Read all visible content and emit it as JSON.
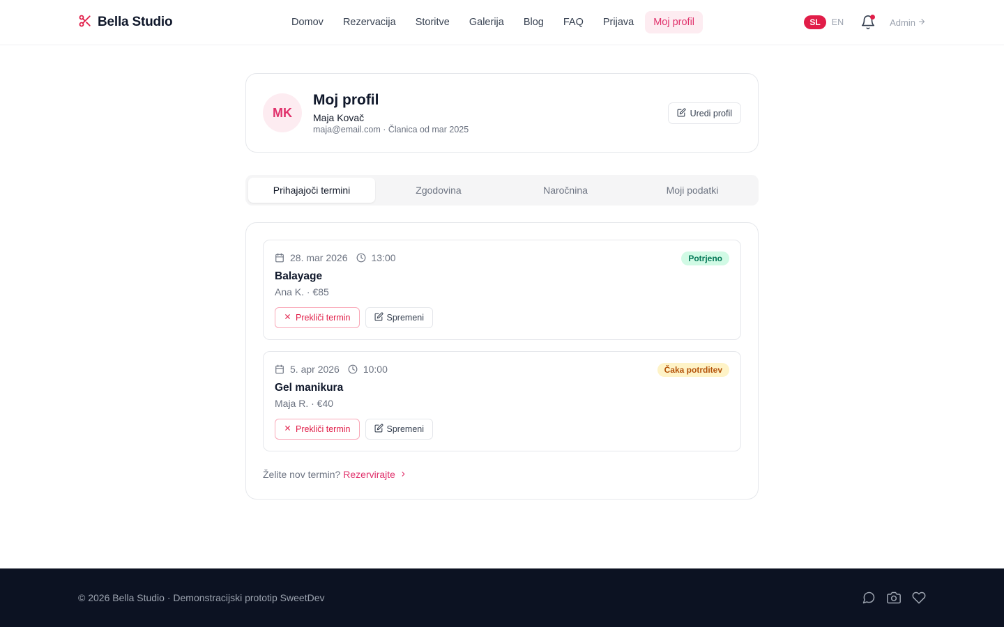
{
  "brand": {
    "name": "Bella Studio",
    "icon": "scissors-icon"
  },
  "nav": {
    "items": [
      {
        "label": "Domov"
      },
      {
        "label": "Rezervacija"
      },
      {
        "label": "Storitve"
      },
      {
        "label": "Galerija"
      },
      {
        "label": "Blog"
      },
      {
        "label": "FAQ"
      },
      {
        "label": "Prijava"
      },
      {
        "label": "Moj profil",
        "active": true
      }
    ]
  },
  "header": {
    "lang_active": "SL",
    "lang_other": "EN",
    "admin_label": "Admin",
    "notification_icon": "bell-icon"
  },
  "profile": {
    "initials": "MK",
    "title": "Moj profil",
    "name": "Maja Kovač",
    "meta": "maja@email.com · Članica od mar 2025",
    "edit_label": "Uredi profil"
  },
  "tabs": [
    {
      "label": "Prihajajoči termini",
      "active": true
    },
    {
      "label": "Zgodovina"
    },
    {
      "label": "Naročnina"
    },
    {
      "label": "Moji podatki"
    }
  ],
  "appointments": [
    {
      "date": "28. mar 2026",
      "time": "13:00",
      "status": "Potrjeno",
      "status_color": "#047857",
      "service": "Balayage",
      "detail": "Ana K. · €85",
      "cancel_label": "Prekliči termin",
      "change_label": "Spremeni"
    },
    {
      "date": "5. apr 2026",
      "time": "10:00",
      "status": "Čaka potrditev",
      "status_color": "#b45309",
      "service": "Gel manikura",
      "detail": "Maja R. · €40",
      "cancel_label": "Prekliči termin",
      "change_label": "Spremeni"
    }
  ],
  "new_appointment": {
    "prompt": "Želite nov termin?",
    "link": "Rezervirajte"
  },
  "footer": {
    "text": "© 2026 Bella Studio · Demonstracijski prototip SweetDev",
    "icons": [
      "chat-icon",
      "camera-icon",
      "heart-icon"
    ]
  },
  "colors": {
    "accent": "#e0316b",
    "footer_bg": "#0c1222"
  }
}
